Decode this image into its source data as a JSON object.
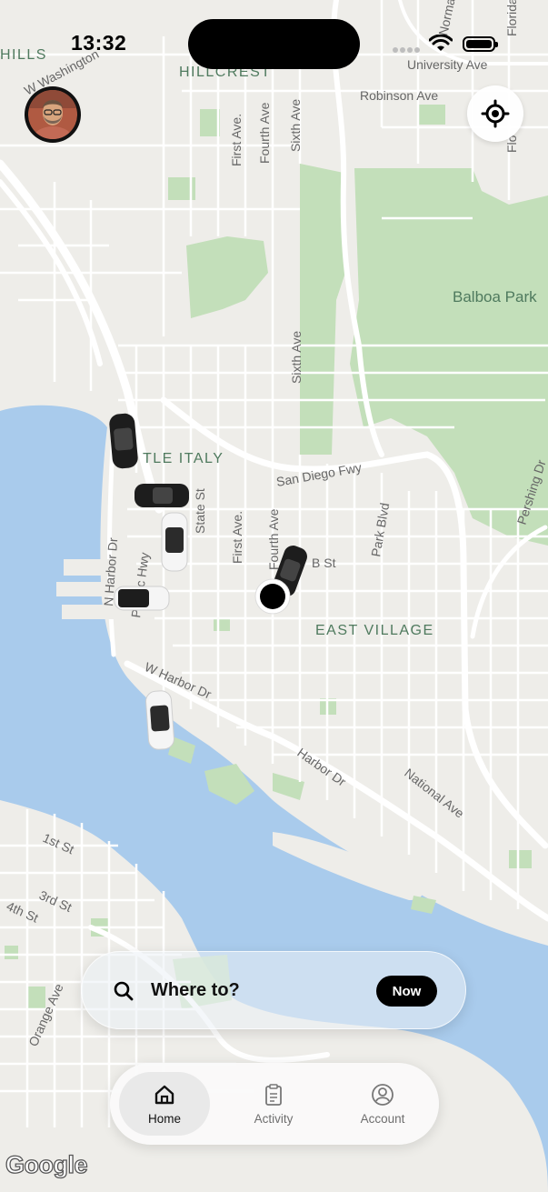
{
  "status_bar": {
    "time": "13:32"
  },
  "map": {
    "labels": {
      "hills": "HILLS",
      "washington": "W Washington",
      "hillcrest": "HILLCREST",
      "university_ave": "University Ave",
      "normal": "Normal",
      "florida_top": "Florida",
      "florida_mid": "Flo",
      "robinson": "Robinson Ave",
      "first_ave_top": "First Ave.",
      "fourth_ave_top": "Fourth Ave",
      "sixth_ave_top": "Sixth Ave",
      "sixth_ave_mid": "Sixth Ave",
      "balboa": "Balboa Park",
      "little_italy": "TLE ITALY",
      "san_diego_fwy": "San Diego Fwy",
      "pershing": "Pershing Dr",
      "state_st": "State St",
      "first_ave_mid": "First Ave.",
      "fourth_ave_mid": "Fourth Ave",
      "park_blvd": "Park Blvd",
      "b_st": "B St",
      "n_harbor": "N Harbor Dr",
      "pacific_hwy": "Pacific Hwy",
      "east_village": "EAST VILLAGE",
      "w_harbor": "W Harbor Dr",
      "harbor_dr": "Harbor Dr",
      "national_ave": "National Ave",
      "first_st": "1st St",
      "third_st": "3rd St",
      "fourth_st": "4th St",
      "orange_ave": "Orange Ave"
    },
    "attribution": "Google"
  },
  "profile": {
    "avatar_icon": "avatar-photo"
  },
  "locate": {
    "icon": "location-target-icon"
  },
  "search": {
    "placeholder": "Where to?",
    "now_label": "Now"
  },
  "tabs": [
    {
      "label": "Home",
      "icon": "home-icon",
      "active": true
    },
    {
      "label": "Activity",
      "icon": "clipboard-icon",
      "active": false
    },
    {
      "label": "Account",
      "icon": "account-icon",
      "active": false
    }
  ],
  "colors": {
    "land": "#eeede9",
    "water": "#a9cbec",
    "park": "#c3dfba",
    "road": "#ffffff",
    "accent": "#000000"
  }
}
